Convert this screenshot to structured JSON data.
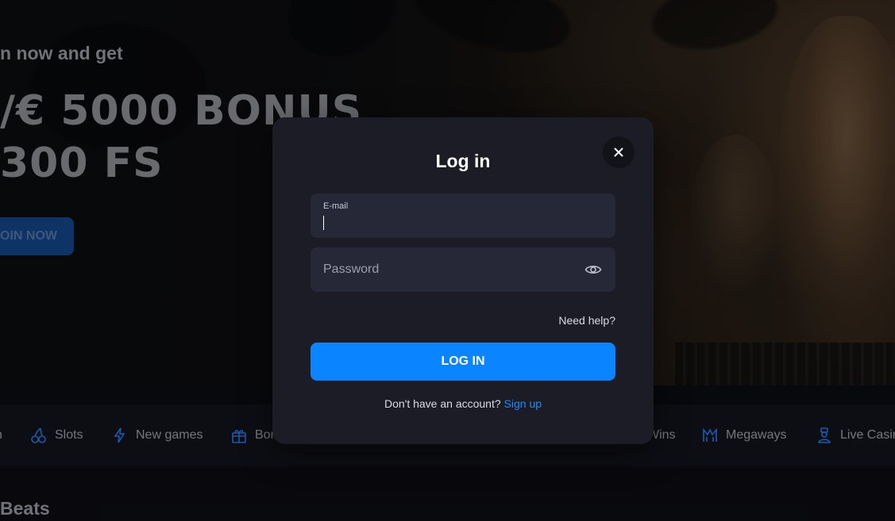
{
  "hero": {
    "line1": "n now and get",
    "line2": "/€ 5000 BONUS",
    "line3": "300 FS",
    "join_button": "OIN NOW"
  },
  "nav": {
    "items": [
      {
        "label": "n",
        "icon": "partial-icon"
      },
      {
        "label": "Slots",
        "icon": "cherries-icon"
      },
      {
        "label": "New games",
        "icon": "lightning-icon"
      },
      {
        "label": "Bon",
        "icon": "gift-icon"
      },
      {
        "label": "Wins",
        "icon": "trophy-icon"
      },
      {
        "label": "Megaways",
        "icon": "megaways-icon"
      },
      {
        "label": "Live Casin",
        "icon": "dealer-icon"
      }
    ],
    "icon_color": "#1f6fd6"
  },
  "section_title": "Beats",
  "modal": {
    "title": "Log in",
    "email_label": "E-mail",
    "email_value": "",
    "password_placeholder": "Password",
    "need_help": "Need help?",
    "login_button": "LOG IN",
    "no_account_text": "Don't have an account?",
    "signup_link": "Sign up",
    "accent_color": "#0a84ff"
  }
}
